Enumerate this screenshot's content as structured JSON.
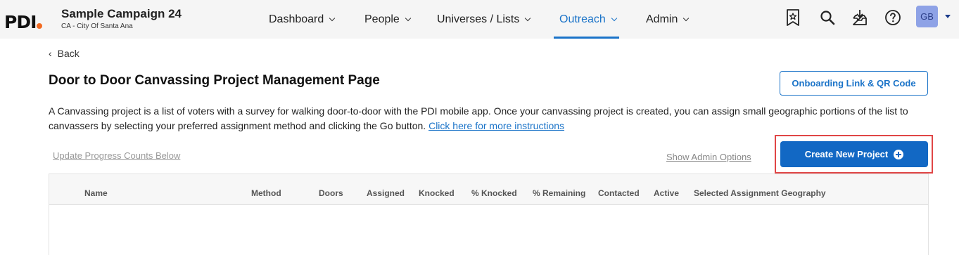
{
  "brand": {
    "logo_text": "PDI",
    "accent_color": "#f26a21"
  },
  "campaign": {
    "name": "Sample Campaign 24",
    "location": "CA - City Of Santa Ana"
  },
  "nav": {
    "items": [
      {
        "label": "Dashboard",
        "active": false
      },
      {
        "label": "People",
        "active": false
      },
      {
        "label": "Universes / Lists",
        "active": false
      },
      {
        "label": "Outreach",
        "active": true
      },
      {
        "label": "Admin",
        "active": false
      }
    ],
    "active_color": "#1a73c8"
  },
  "toolbar_icons": [
    "bookmark-star-icon",
    "search-icon",
    "download-inbox-icon",
    "help-icon"
  ],
  "user": {
    "initials": "GB",
    "avatar_color": "#8ea2e6"
  },
  "page": {
    "back_label": "Back",
    "title": "Door to Door Canvassing Project Management Page",
    "onboarding_button": "Onboarding Link & QR Code",
    "description": "A Canvassing project is a list of voters with a survey for walking door-to-door with the PDI mobile app. Once your canvassing project is created, you can assign small geographic portions of the list to canvassers by selecting your preferred assignment method and clicking the Go button.",
    "instructions_link": "Click here for more instructions",
    "update_progress_link": "Update Progress Counts Below",
    "show_admin_link": "Show Admin Options",
    "create_button": "Create New Project",
    "primary_color": "#1268c4",
    "highlight_color": "#e04646"
  },
  "table": {
    "columns": [
      "Name",
      "Method",
      "Doors",
      "Assigned",
      "Knocked",
      "% Knocked",
      "% Remaining",
      "Contacted",
      "Active",
      "Selected Assignment Geography"
    ],
    "rows": []
  }
}
